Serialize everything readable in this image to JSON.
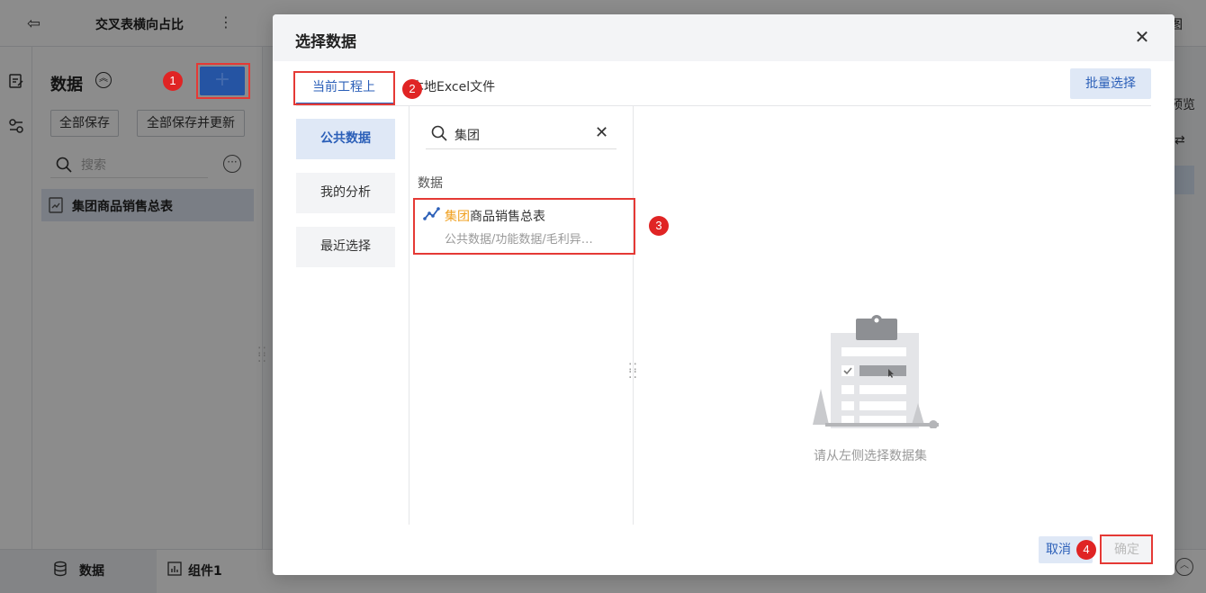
{
  "app": {
    "report_title": "交叉表横向占比",
    "right_edge_text": "图",
    "right_panel_text": "预览"
  },
  "data_panel": {
    "title": "数据",
    "add_label": "+",
    "save_all": "全部保存",
    "save_all_update": "全部保存并更新",
    "search_placeholder": "搜索",
    "items": [
      {
        "label": "集团商品销售总表"
      }
    ]
  },
  "bottom_tabs": [
    {
      "label": "数据"
    },
    {
      "label": "组件1"
    }
  ],
  "modal": {
    "title": "选择数据",
    "tabs": [
      {
        "label": "当前工程上"
      },
      {
        "label": "本地Excel文件"
      }
    ],
    "batch_select": "批量选择",
    "categories": [
      {
        "label": "公共数据"
      },
      {
        "label": "我的分析"
      },
      {
        "label": "最近选择"
      }
    ],
    "search_value": "集团",
    "section_label": "数据",
    "result": {
      "name_highlight": "集团",
      "name_rest": "商品销售总表",
      "path": "公共数据/功能数据/毛利异…"
    },
    "empty_text": "请从左侧选择数据集",
    "cancel": "取消",
    "confirm": "确定"
  },
  "badges": [
    "1",
    "2",
    "3",
    "4"
  ],
  "colors": {
    "primary": "#2b5fb8",
    "highlight": "#f0a020",
    "annotation_red": "#e02424"
  }
}
